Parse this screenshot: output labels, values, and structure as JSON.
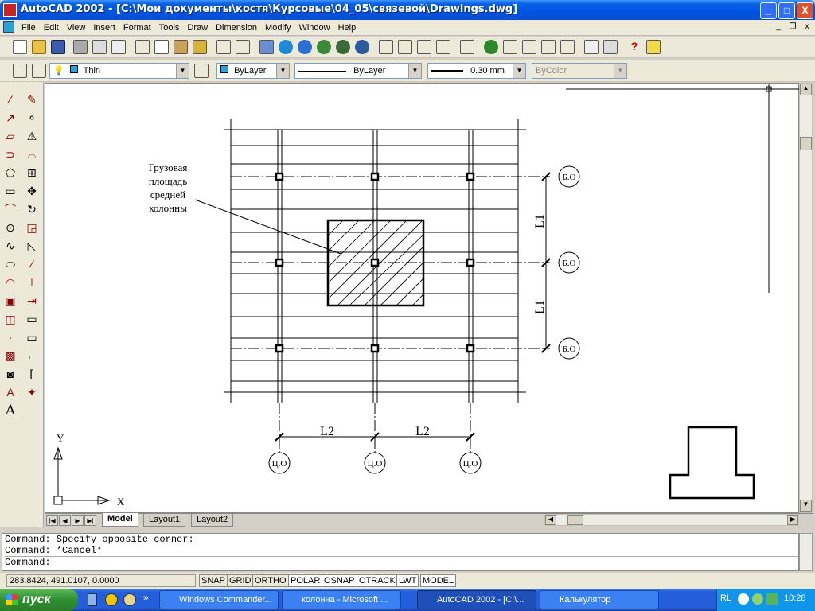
{
  "window": {
    "title": "AutoCAD 2002 - [C:\\Мои документы\\костя\\Курсовые\\04_05\\связевой\\Drawings.dwg]"
  },
  "caption_buttons": {
    "minimize": "_",
    "maximize": "□",
    "close": "X"
  },
  "menu": [
    "File",
    "Edit",
    "View",
    "Insert",
    "Format",
    "Tools",
    "Draw",
    "Dimension",
    "Modify",
    "Window",
    "Help"
  ],
  "mdi_buttons": {
    "minimize": "_",
    "restore": "❐",
    "close": "x"
  },
  "layer_toolbar": {
    "layer_name": "Thin",
    "color": "ByLayer",
    "linetype": "ByLayer",
    "lineweight": "0.30 mm",
    "plotstyle": "ByColor"
  },
  "drawing": {
    "annotation_lines": [
      "Грузовая",
      "площадь",
      "средней",
      "колонны"
    ],
    "axis_row_labels": [
      "Б.О",
      "Б.О",
      "Б.О"
    ],
    "axis_col_labels": [
      "Ц.О",
      "Ц.О",
      "Ц.О"
    ],
    "dim_l1": "L1",
    "dim_l2": "L2",
    "ucs_x": "X",
    "ucs_y": "Y"
  },
  "layout_tabs": [
    "Model",
    "Layout1",
    "Layout2"
  ],
  "tab_nav": [
    "|◀",
    "◀",
    "▶",
    "▶|"
  ],
  "command_history": [
    "Command: Specify opposite corner:",
    "Command: *Cancel*",
    "Command:"
  ],
  "status": {
    "coords": "283.8424, 491.0107, 0.0000",
    "buttons": [
      "SNAP",
      "GRID",
      "ORTHO",
      "POLAR",
      "OSNAP",
      "OTRACK",
      "LWT",
      "MODEL"
    ]
  },
  "taskbar": {
    "start": "пуск",
    "tasks": [
      "Windows Commander...",
      "колонна - Microsoft ...",
      "AutoCAD 2002 - [C:\\...",
      "Калькулятор"
    ],
    "lang": "RL",
    "clock": "10:28"
  }
}
